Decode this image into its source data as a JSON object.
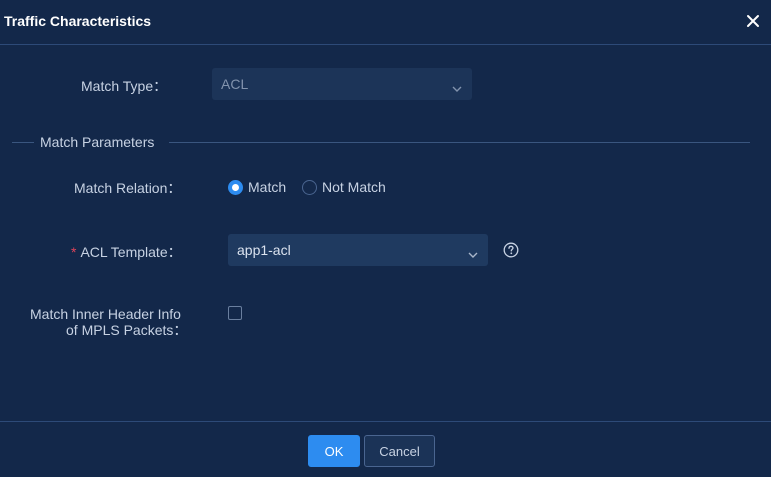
{
  "dialog": {
    "title": "Traffic Characteristics"
  },
  "match_type": {
    "label": "Match Type：",
    "value": "ACL"
  },
  "section": {
    "title": "Match Parameters"
  },
  "match_relation": {
    "label": "Match Relation：",
    "options": [
      "Match",
      "Not Match"
    ],
    "selected": "Match"
  },
  "acl_template": {
    "required_mark": "*",
    "label": "ACL Template：",
    "value": "app1-acl"
  },
  "mpls": {
    "label_line1": "Match Inner Header Info",
    "label_line2": "of MPLS Packets：",
    "checked": false
  },
  "footer": {
    "ok_label": "OK",
    "cancel_label": "Cancel"
  },
  "colors": {
    "background": "#13284a",
    "accent": "#2d8cf0",
    "required": "#e0445a"
  }
}
